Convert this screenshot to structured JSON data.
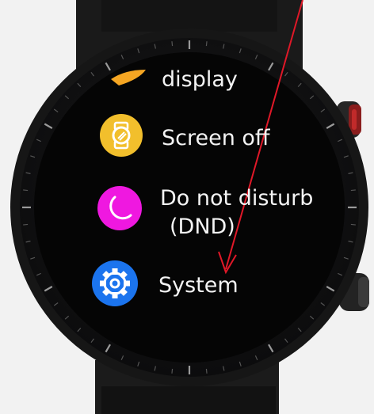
{
  "watch": {
    "menu": [
      {
        "label": "display",
        "icon": "display-icon",
        "icon_color": "#f5a623"
      },
      {
        "label": "Screen off",
        "icon": "watch-icon",
        "icon_color": "#f2bf2c"
      },
      {
        "label_line1": "Do not disturb",
        "label_line2": "(DND)",
        "icon": "moon-icon",
        "icon_color": "#ef18e0"
      },
      {
        "label": "System",
        "icon": "gear-icon",
        "icon_color": "#1b74ee"
      }
    ]
  },
  "annotation": {
    "arrow_color": "#e01828"
  }
}
